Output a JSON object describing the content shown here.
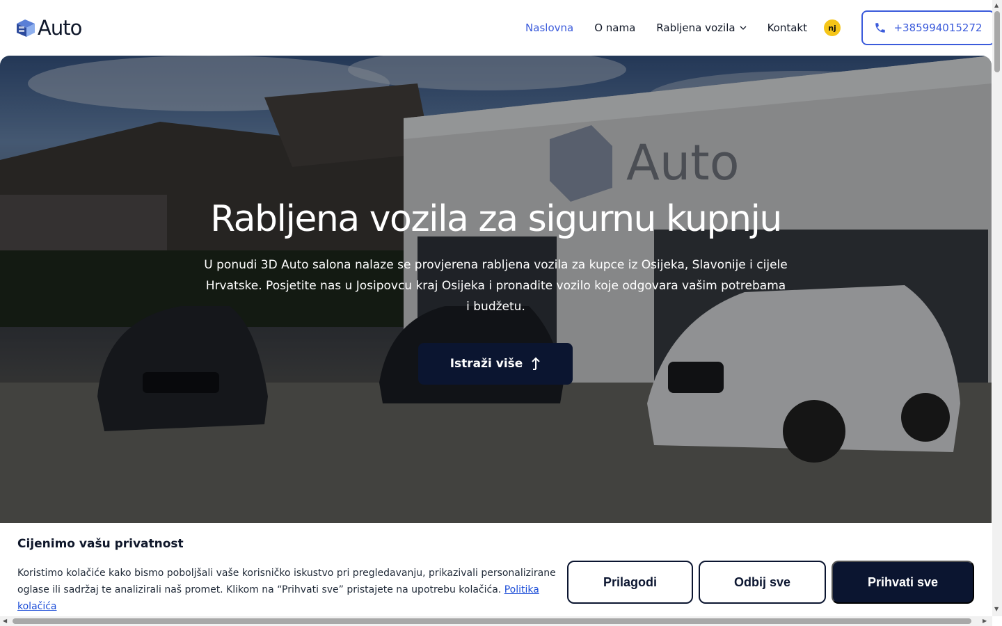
{
  "header": {
    "logo_text": "Auto",
    "nav": [
      {
        "label": "Naslovna",
        "active": true
      },
      {
        "label": "O nama",
        "active": false
      },
      {
        "label": "Rabljena vozila",
        "active": false,
        "has_dropdown": true
      },
      {
        "label": "Kontakt",
        "active": false
      }
    ],
    "lang_badge": "nj",
    "phone": "+385994015272"
  },
  "hero": {
    "title": "Rabljena vozila za sigurnu kupnju",
    "text": "U ponudi 3D Auto salona nalaze se provjerena rabljena vozila za kupce iz Osijeka, Slavonije i cijele Hrvatske. Posjetite nas u Josipovcu kraj Osijeka i pronadite vozilo koje odgovara vašim potrebama i budžetu.",
    "cta_label": "Istraži više",
    "building_sign": "Auto"
  },
  "cookie": {
    "title": "Cijenimo vašu privatnost",
    "text": "Koristimo kolačiće kako bismo poboljšali vaše korisničko iskustvo pri pregledavanju, prikazivali personalizirane oglase ili sadržaj te analizirali naš promet. Klikom na “Prihvati sve” pristajete na upotrebu kolačića.",
    "link": "Politika kolačića",
    "buttons": {
      "customize": "Prilagodi",
      "reject": "Odbij sve",
      "accept": "Prihvati sve"
    }
  },
  "colors": {
    "accent": "#3b5bdb",
    "navy": "#0b1530",
    "badge": "#f5c518"
  }
}
